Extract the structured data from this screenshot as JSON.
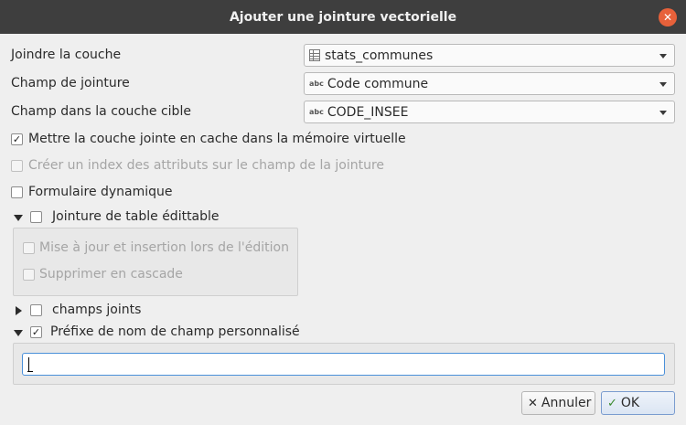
{
  "window": {
    "title": "Ajouter une jointure vectorielle"
  },
  "fields": {
    "join_layer": {
      "label": "Joindre la couche",
      "value": "stats_communes",
      "icon": "table-icon"
    },
    "join_field": {
      "label": "Champ de jointure",
      "value": "Code commune",
      "icon": "abc-text-field-icon"
    },
    "target_field": {
      "label": "Champ dans la couche cible",
      "value": "CODE_INSEE",
      "icon": "abc-text-field-icon"
    },
    "abc_glyph": "abc"
  },
  "options": {
    "cache": {
      "label": "Mettre la couche jointe en cache dans la mémoire virtuelle",
      "checked": true,
      "enabled": true
    },
    "index": {
      "label": "Créer un index des attributs sur le champ de la jointure",
      "checked": false,
      "enabled": false
    },
    "dynamic_form": {
      "label": "Formulaire dynamique",
      "checked": false,
      "enabled": true
    }
  },
  "editable_group": {
    "label": "Jointure de table édittable",
    "expanded": true,
    "checked": false,
    "children": {
      "upsert": {
        "label": "Mise à jour et insertion lors de l'édition",
        "checked": false,
        "enabled": false
      },
      "cascade": {
        "label": "Supprimer en cascade",
        "checked": false,
        "enabled": false
      }
    }
  },
  "joined_fields_group": {
    "label": "champs joints",
    "expanded": false,
    "checked": false
  },
  "prefix_group": {
    "label": "Préfixe de nom de champ personnalisé",
    "expanded": true,
    "checked": true,
    "value": ""
  },
  "buttons": {
    "cancel": {
      "label": "Annuler",
      "icon": "x-icon"
    },
    "ok": {
      "label": "OK",
      "icon": "check-icon"
    }
  },
  "glyphs": {
    "check": "✓",
    "close": "✕"
  }
}
